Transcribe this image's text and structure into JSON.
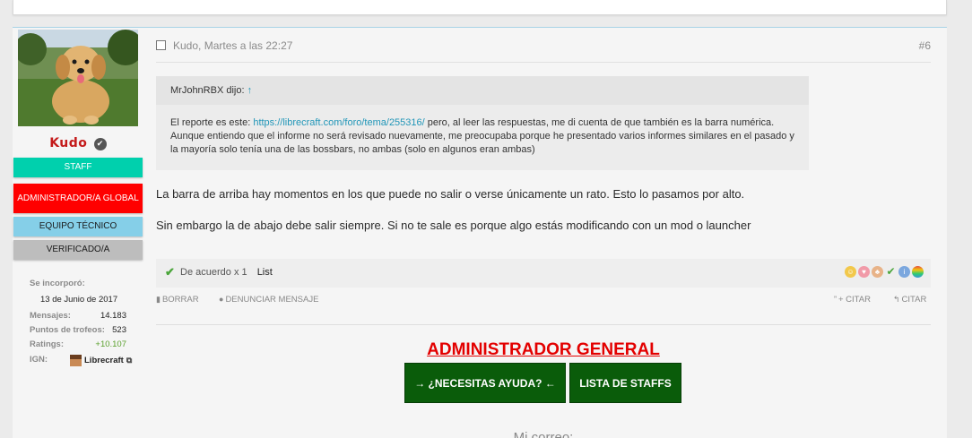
{
  "user": {
    "username": "Kudo",
    "badges": [
      "STAFF",
      "ADMINISTRADOR/A GLOBAL",
      "EQUIPO TÉCNICO",
      "VERIFICADO/A"
    ],
    "badge_colors": [
      "#00d0ad",
      "#ff0000",
      "#85cfe8",
      "#bdbdbd"
    ],
    "stats": {
      "joined_label": "Se incorporó:",
      "joined_value": "13 de Junio de 2017",
      "messages_label": "Mensajes:",
      "messages_value": "14.183",
      "trophies_label": "Puntos de trofeos:",
      "trophies_value": "523",
      "ratings_label": "Ratings:",
      "ratings_value": "+10.107",
      "ign_label": "IGN:",
      "ign_value": "Librecraft"
    }
  },
  "post": {
    "author_date": "Kudo, Martes a las 22:27",
    "number": "#6",
    "quote": {
      "author": "MrJohnRBX dijo:",
      "text_before_link": "El reporte es este: ",
      "link": "https://librecraft.com/foro/tema/255316/",
      "text_after_link": " pero, al leer las respuestas, me di cuenta de que también es la barra numérica. Aunque entiendo que el informe no será revisado nuevamente, me preocupaba porque he presentado varios informes similares en el pasado y la mayoría solo tenía una de las bossbars, no ambas (solo en algunos eran ambas)"
    },
    "paragraphs": [
      "La barra de arriba hay momentos en los que puede no salir o verse únicamente un rato. Esto lo pasamos por alto.",
      "Sin embargo la de abajo debe salir siempre. Si no te sale es porque algo estás modificando con un mod o launcher"
    ],
    "likes": {
      "label": "De acuerdo",
      "count": "x 1",
      "user": "List"
    },
    "actions": {
      "delete": "BORRAR",
      "report": "DENUNCIAR MENSAJE",
      "multiquote": "+ CITAR",
      "quote": "CITAR"
    }
  },
  "signature": {
    "title": "ADMINISTRADOR GENERAL",
    "help_button": "→ ¿NECESITAS AYUDA? ←",
    "staff_button": "LISTA DE STAFFS",
    "mail_label": "Mi correo:"
  },
  "colors": {
    "username": "#c41a1a",
    "link": "#2196b8",
    "signature_title": "#e30000",
    "signature_button": "#0a5c0a",
    "ratings_positive": "#5aa02c"
  }
}
